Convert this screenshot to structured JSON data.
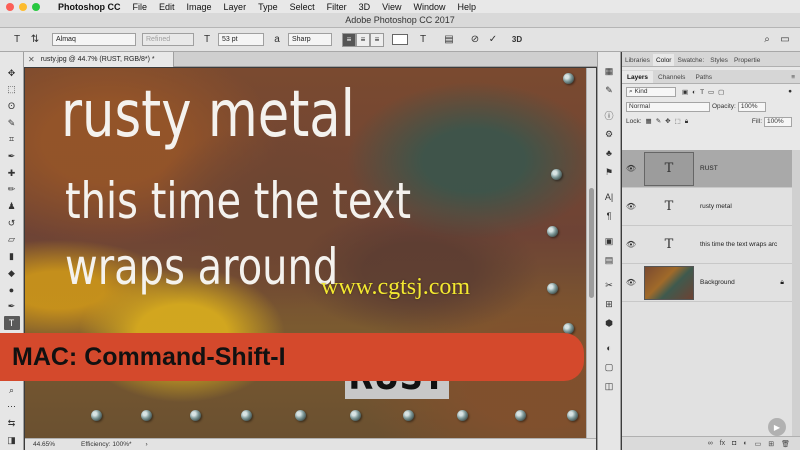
{
  "menubar": {
    "app_name": "Photoshop CC",
    "items": [
      "File",
      "Edit",
      "Image",
      "Layer",
      "Type",
      "Select",
      "Filter",
      "3D",
      "View",
      "Window",
      "Help"
    ]
  },
  "window_title": "Adobe Photoshop CC 2017",
  "options": {
    "font_family": "Almaq",
    "font_style": "Refined",
    "font_size": "53 pt",
    "antialias": "Sharp",
    "threed_label": "3D"
  },
  "document_tab": "rusty.jpg @ 44.7% (RUST, RGB/8*) *",
  "canvas": {
    "line1": "rusty metal",
    "line2": "this time the text",
    "line3": "wraps around",
    "rust_word": "RUST",
    "watermark": "www.cgtsj.com",
    "banner": "MAC: Command-Shift-I"
  },
  "statusbar": {
    "zoom": "44.65%",
    "efficiency": "Efficiency: 100%*"
  },
  "panels": {
    "top_tabs": [
      "Libraries",
      "Color",
      "Swatche:",
      "Styles",
      "Propertie"
    ],
    "layer_tabs": [
      "Layers",
      "Channels",
      "Paths"
    ],
    "filter_kind": "Kind",
    "blend_mode": "Normal",
    "opacity_label": "Opacity:",
    "opacity_value": "100%",
    "lock_label": "Lock:",
    "fill_label": "Fill:",
    "fill_value": "100%"
  },
  "layers": [
    {
      "name": "RUST",
      "thumb": "T",
      "selected": true
    },
    {
      "name": "rusty metal",
      "thumb": "T",
      "selected": false
    },
    {
      "name": "this time the text wraps arc",
      "thumb": "T",
      "selected": false
    },
    {
      "name": "Background",
      "thumb": "",
      "selected": false
    }
  ],
  "colors": {
    "banner": "#d4492c",
    "watermark": "#f3e830",
    "selected_layer": "#a9a9a9"
  }
}
